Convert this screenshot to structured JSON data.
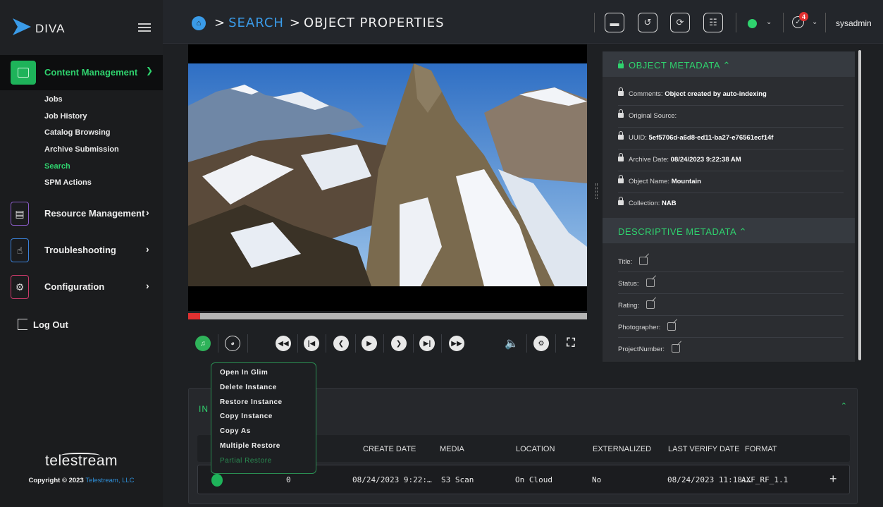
{
  "app": {
    "name": "DIVA"
  },
  "sidebar": {
    "content_management": {
      "label": "Content Management",
      "items": [
        "Jobs",
        "Job History",
        "Catalog Browsing",
        "Archive Submission",
        "Search",
        "SPM Actions"
      ],
      "active_item": "Search"
    },
    "nav": [
      {
        "label": "Resource Management",
        "icon": "database-icon",
        "color": "#8a5cc8"
      },
      {
        "label": "Troubleshooting",
        "icon": "hand-pointer-icon",
        "color": "#3a80d8"
      },
      {
        "label": "Configuration",
        "icon": "gear-icon",
        "color": "#c83a6a"
      }
    ],
    "logout": "Log Out",
    "footer": {
      "brand": "telestream",
      "copyright": "Copyright © 2023",
      "company": "Telestream, LLC"
    }
  },
  "header": {
    "breadcrumb": [
      "SEARCH",
      "OBJECT PROPERTIES"
    ],
    "notification_count": "4",
    "user": "sysadmin",
    "status_color": "#2fd36e"
  },
  "metadata": {
    "object_title": "OBJECT METADATA",
    "object_fields": [
      {
        "label": "Comments:",
        "value": "Object created by auto-indexing"
      },
      {
        "label": "Original Source:",
        "value": ""
      },
      {
        "label": "UUID:",
        "value": "5ef5706d-a6d8-ed11-ba27-e76561ecf14f"
      },
      {
        "label": "Archive Date:",
        "value": "08/24/2023 9:22:38 AM"
      },
      {
        "label": "Object Name:",
        "value": "Mountain"
      },
      {
        "label": "Collection:",
        "value": "NAB"
      }
    ],
    "descriptive_title": "DESCRIPTIVE METADATA",
    "descriptive_fields": [
      "Title:",
      "Status:",
      "Rating:",
      "Photographer:",
      "ProjectNumber:"
    ]
  },
  "player": {
    "progress_fraction": 0.005
  },
  "instances": {
    "title_prefix": "IN",
    "columns": [
      "CREATE DATE",
      "MEDIA",
      "LOCATION",
      "EXTERNALIZED",
      "LAST VERIFY DATE",
      "FORMAT"
    ],
    "rows": [
      {
        "id": "0",
        "create_date": "08/24/2023 9:22:…",
        "media": "S3 Scan",
        "location": "On Cloud",
        "externalized": "No",
        "last_verify": "08/24/2023 11:18:…",
        "format": "AXF_RF_1.1"
      }
    ]
  },
  "context_menu": {
    "items": [
      "Open In Glim",
      "Delete Instance",
      "Restore Instance",
      "Copy Instance",
      "Copy As",
      "Multiple Restore",
      "Partial Restore"
    ],
    "disabled_item": "Partial Restore"
  },
  "colors": {
    "accent": "#2fd36e",
    "link": "#3a9be8",
    "badge": "#e03131"
  }
}
